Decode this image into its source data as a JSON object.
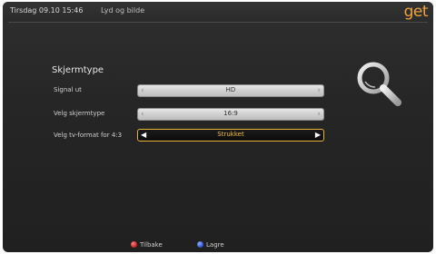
{
  "topbar": {
    "datetime": "Tirsdag 09.10 15:46",
    "breadcrumb": "Lyd og bilde",
    "logo": "get"
  },
  "section": {
    "title": "Skjermtype"
  },
  "settings": [
    {
      "label": "Signal ut",
      "value": "HD"
    },
    {
      "label": "Velg skjermtype",
      "value": "16:9"
    },
    {
      "label": "Velg tv-format for 4:3",
      "value": "Strukket"
    }
  ],
  "footer": {
    "back_label": "Tilbake",
    "save_label": "Lagre"
  },
  "icons": {
    "magnifier": "search-icon",
    "prev": "chevron-left-icon",
    "next": "chevron-right-icon"
  },
  "colors": {
    "accent": "#e9b43a",
    "logo": "#f0a33c",
    "back_button": "#c81e1e",
    "save_button": "#2a4fd0"
  }
}
